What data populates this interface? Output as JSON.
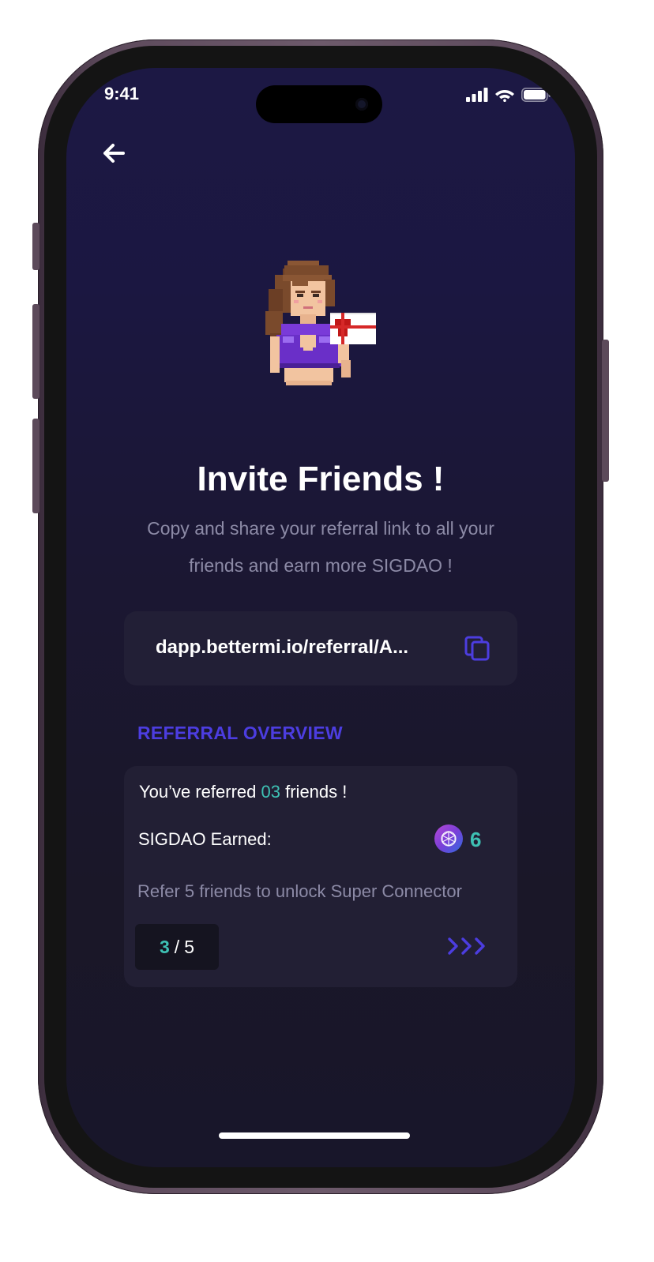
{
  "status_bar": {
    "time": "9:41",
    "icons": [
      "signal-icon",
      "wifi-icon",
      "battery-icon"
    ]
  },
  "header": {
    "back_icon": "arrow-left-icon"
  },
  "hero": {
    "title": "Invite Friends !",
    "subtitle": "Copy and share your referral link to all your friends and earn more SIGDAO !"
  },
  "referral_link": {
    "value": "dapp.bettermi.io/referral/A...",
    "copy_icon": "copy-icon"
  },
  "overview": {
    "label": "REFERRAL OVERVIEW",
    "referred_prefix": "You’ve referred ",
    "referred_count": "03",
    "referred_suffix": " friends !",
    "earned_label": "SIGDAO Earned:",
    "earned_value": "6",
    "unlock_text": "Refer 5 friends to unlock Super Connector",
    "progress_current": "3",
    "progress_separator": "/",
    "progress_total": "5",
    "progress_fraction": 0.6
  },
  "colors": {
    "background": "#1b1741",
    "accent_teal": "#3ec1b4",
    "accent_purple": "#4c3de0",
    "card": "#221f36",
    "muted_text": "#8c8aa6"
  }
}
